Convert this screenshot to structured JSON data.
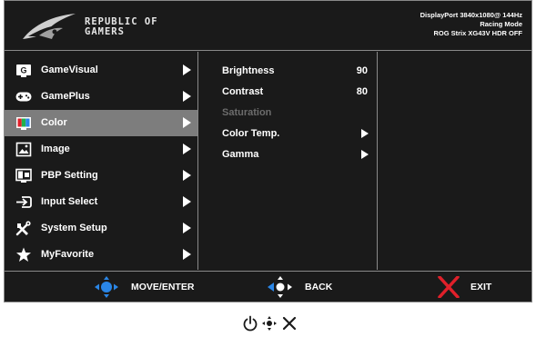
{
  "header": {
    "brand_line1": "REPUBLIC OF",
    "brand_line2": "GAMERS",
    "status_line1": "DisplayPort 3840x1080@ 144Hz",
    "status_line2": "Racing Mode",
    "status_line3": "ROG Strix XG43V HDR OFF"
  },
  "main_menu": {
    "selected_index": 2,
    "items": [
      {
        "label": "GameVisual",
        "icon": "gamevisual-icon"
      },
      {
        "label": "GamePlus",
        "icon": "gamepad-icon"
      },
      {
        "label": "Color",
        "icon": "color-icon"
      },
      {
        "label": "Image",
        "icon": "image-icon"
      },
      {
        "label": "PBP Setting",
        "icon": "pbp-icon"
      },
      {
        "label": "Input Select",
        "icon": "input-select-icon"
      },
      {
        "label": "System Setup",
        "icon": "tools-icon"
      },
      {
        "label": "MyFavorite",
        "icon": "star-icon"
      }
    ]
  },
  "submenu": {
    "items": [
      {
        "label": "Brightness",
        "value": "90"
      },
      {
        "label": "Contrast",
        "value": "80"
      },
      {
        "label": "Saturation",
        "value": "",
        "disabled": true
      },
      {
        "label": "Color Temp.",
        "value": ""
      },
      {
        "label": "Gamma",
        "value": ""
      }
    ]
  },
  "footer": {
    "move_enter_label": "MOVE/ENTER",
    "back_label": "BACK",
    "exit_label": "EXIT"
  },
  "hardware_buttons": [
    "power-icon",
    "joystick-icon",
    "close-icon"
  ],
  "colors": {
    "background": "#1a1a1a",
    "selected": "#7d7d7d",
    "accent_blue": "#2a86e6",
    "exit_red": "#e0202a"
  }
}
